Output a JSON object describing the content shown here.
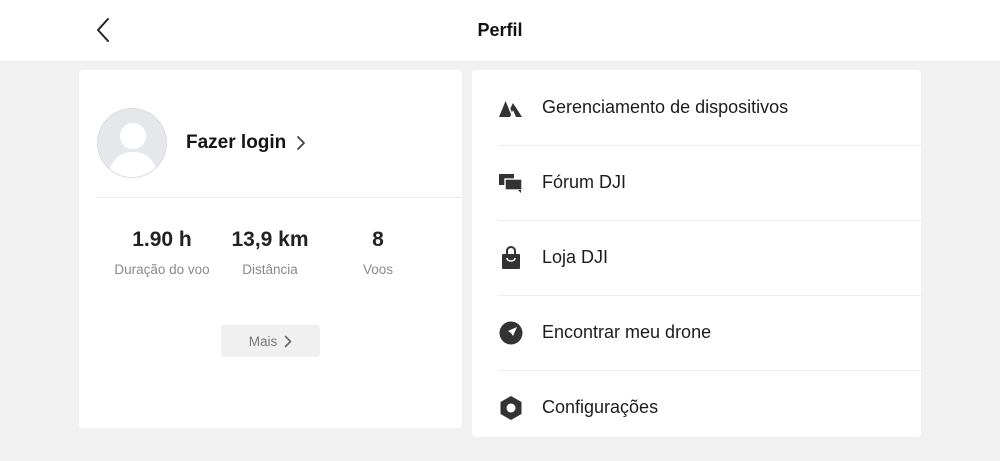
{
  "header": {
    "title": "Perfil",
    "back_icon": "chevron-left-icon"
  },
  "profile": {
    "login_label": "Fazer login",
    "avatar_icon": "user-silhouette-icon",
    "stats": [
      {
        "value": "1.90 h",
        "label": "Duração do voo"
      },
      {
        "value": "13,9 km",
        "label": "Distância"
      },
      {
        "value": "8",
        "label": "Voos"
      }
    ],
    "more_label": "Mais"
  },
  "menu": {
    "items": [
      {
        "label": "Gerenciamento de dispositivos",
        "icon": "devices-icon"
      },
      {
        "label": "Fórum DJI",
        "icon": "forum-icon"
      },
      {
        "label": "Loja DJI",
        "icon": "shopping-bag-icon"
      },
      {
        "label": "Encontrar meu drone",
        "icon": "find-drone-icon"
      },
      {
        "label": "Configurações",
        "icon": "settings-icon"
      }
    ]
  },
  "colors": {
    "background": "#f1f1f1",
    "card": "#ffffff",
    "text": "#1f1f1f",
    "secondary_text": "#8a8a8a",
    "icon": "#333333"
  }
}
